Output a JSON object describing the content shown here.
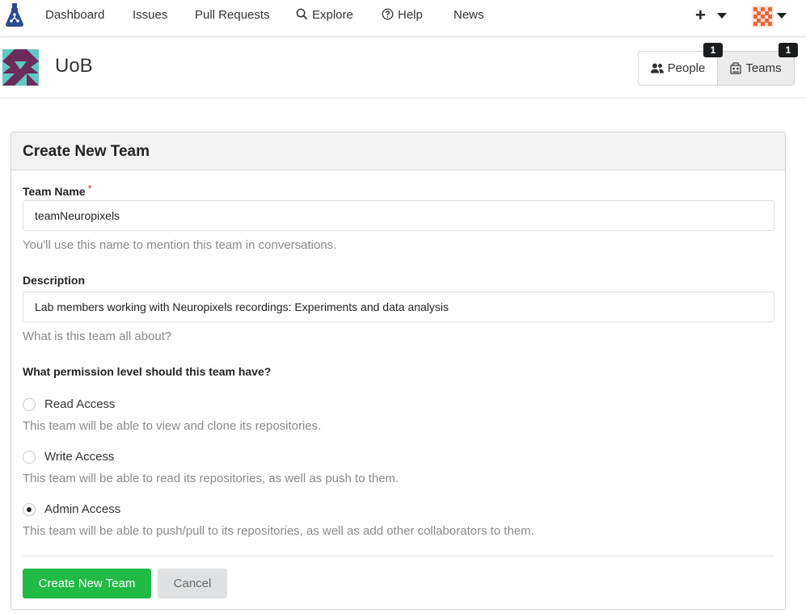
{
  "nav": {
    "items": [
      {
        "label": "Dashboard"
      },
      {
        "label": "Issues"
      },
      {
        "label": "Pull Requests"
      },
      {
        "label": "Explore"
      },
      {
        "label": "Help"
      },
      {
        "label": "News"
      }
    ],
    "plus_label": "+"
  },
  "org": {
    "name": "UoB",
    "tabs": {
      "people": {
        "label": "People",
        "count": "1"
      },
      "teams": {
        "label": "Teams",
        "count": "1"
      }
    }
  },
  "form": {
    "title": "Create New Team",
    "team_name": {
      "label": "Team Name",
      "required_mark": "*",
      "value": "teamNeuropixels",
      "help": "You'll use this name to mention this team in conversations."
    },
    "description": {
      "label": "Description",
      "value": "Lab members working with Neuropixels recordings: Experiments and data analysis",
      "help": "What is this team all about?"
    },
    "permission": {
      "question": "What permission level should this team have?",
      "options": [
        {
          "label": "Read Access",
          "help": "This team will be able to view and clone its repositories.",
          "checked": false
        },
        {
          "label": "Write Access",
          "help": "This team will be able to read its repositories, as well as push to them.",
          "checked": false
        },
        {
          "label": "Admin Access",
          "help": "This team will be able to push/pull to its repositories, as well as add other collaborators to them.",
          "checked": true
        }
      ]
    },
    "submit_label": "Create New Team",
    "cancel_label": "Cancel"
  },
  "colors": {
    "primary_button": "#21ba45",
    "cancel_button": "#e0e1e2",
    "required": "#db2828",
    "logo": "#2a4c8c"
  },
  "icons": [
    "gitea-logo-icon",
    "search-icon",
    "help-circle-icon",
    "plus-icon",
    "caret-down-icon",
    "user-avatar-icon",
    "people-icon",
    "teams-icon",
    "org-avatar-icon"
  ]
}
